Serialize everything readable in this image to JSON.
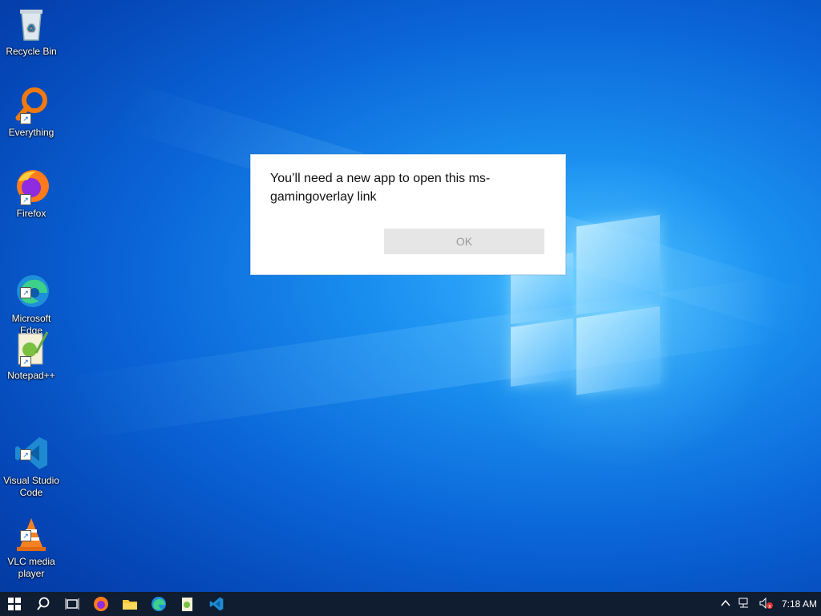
{
  "desktop_icons": [
    {
      "label": "Recycle Bin",
      "icon": "recycle-bin-icon"
    },
    {
      "label": "Everything",
      "icon": "everything-search-icon"
    },
    {
      "label": "Firefox",
      "icon": "firefox-icon"
    },
    {
      "label": "Microsoft\nEdge",
      "icon": "edge-icon"
    },
    {
      "label": "Notepad++",
      "icon": "notepadpp-icon"
    },
    {
      "label": "Visual Studio\nCode",
      "icon": "vscode-icon"
    },
    {
      "label": "VLC media\nplayer",
      "icon": "vlc-icon"
    }
  ],
  "dialog": {
    "message": "You’ll need a new app to open this ms-gamingoverlay link",
    "ok_label": "OK"
  },
  "taskbar": {
    "pinned": [
      "start-icon",
      "search-icon",
      "task-view-icon",
      "firefox-icon",
      "file-explorer-icon",
      "edge-icon",
      "notepadpp-icon",
      "vscode-icon"
    ],
    "clock": "7:18 AM"
  },
  "colors": {
    "taskbar": "#101c30",
    "accent": "#0a64d6"
  }
}
